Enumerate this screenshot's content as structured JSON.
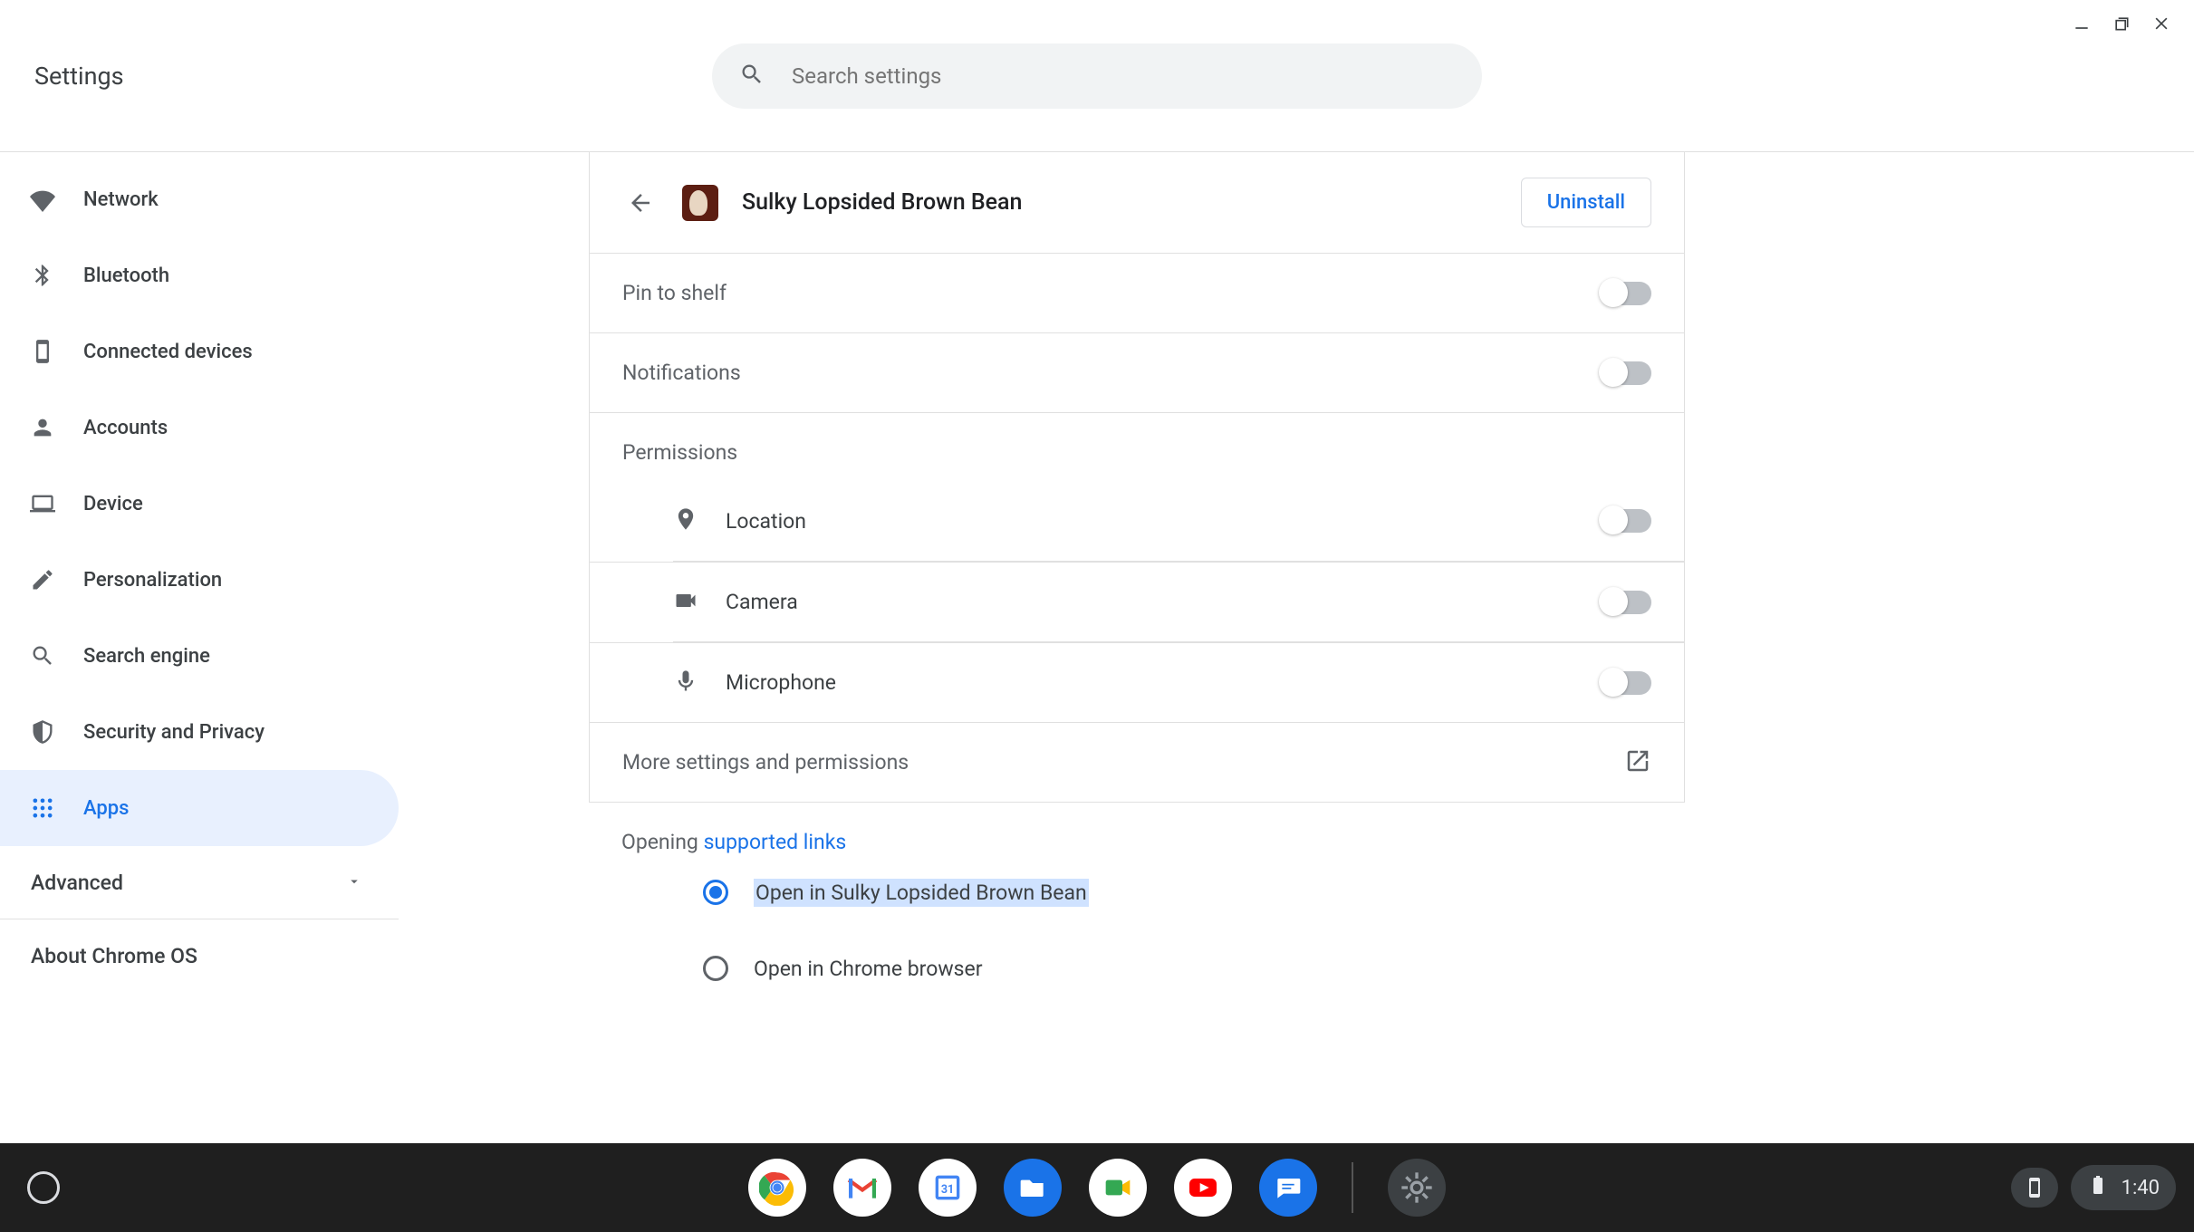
{
  "window": {
    "title": "Settings"
  },
  "search": {
    "placeholder": "Search settings"
  },
  "sidebar": {
    "items": [
      {
        "label": "Network"
      },
      {
        "label": "Bluetooth"
      },
      {
        "label": "Connected devices"
      },
      {
        "label": "Accounts"
      },
      {
        "label": "Device"
      },
      {
        "label": "Personalization"
      },
      {
        "label": "Search engine"
      },
      {
        "label": "Security and Privacy"
      },
      {
        "label": "Apps"
      }
    ],
    "advanced": "Advanced",
    "about": "About Chrome OS"
  },
  "detail": {
    "app_name": "Sulky Lopsided Brown Bean",
    "uninstall": "Uninstall",
    "pin_to_shelf": "Pin to shelf",
    "notifications": "Notifications",
    "permissions_title": "Permissions",
    "permissions": {
      "location": "Location",
      "camera": "Camera",
      "microphone": "Microphone"
    },
    "more": "More settings and permissions",
    "opening_prefix": "Opening ",
    "opening_link": "supported links",
    "radio_open_app": "Open in Sulky Lopsided Brown Bean",
    "radio_open_chrome": "Open in Chrome browser"
  },
  "shelf": {
    "time": "1:40"
  }
}
